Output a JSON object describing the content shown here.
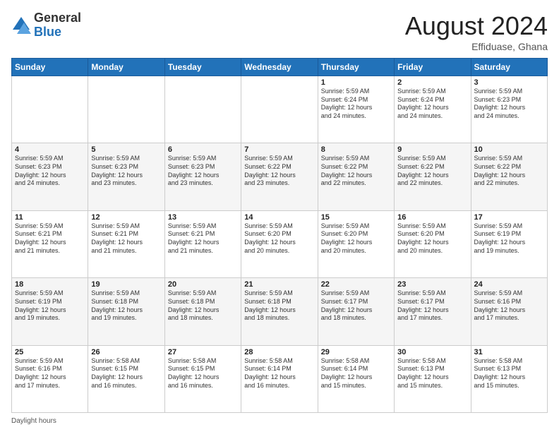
{
  "logo": {
    "general": "General",
    "blue": "Blue"
  },
  "header": {
    "month_year": "August 2024",
    "location": "Effiduase, Ghana"
  },
  "days_of_week": [
    "Sunday",
    "Monday",
    "Tuesday",
    "Wednesday",
    "Thursday",
    "Friday",
    "Saturday"
  ],
  "footer": {
    "daylight_label": "Daylight hours"
  },
  "weeks": [
    [
      {
        "day": "",
        "info": ""
      },
      {
        "day": "",
        "info": ""
      },
      {
        "day": "",
        "info": ""
      },
      {
        "day": "",
        "info": ""
      },
      {
        "day": "1",
        "info": "Sunrise: 5:59 AM\nSunset: 6:24 PM\nDaylight: 12 hours\nand 24 minutes."
      },
      {
        "day": "2",
        "info": "Sunrise: 5:59 AM\nSunset: 6:24 PM\nDaylight: 12 hours\nand 24 minutes."
      },
      {
        "day": "3",
        "info": "Sunrise: 5:59 AM\nSunset: 6:23 PM\nDaylight: 12 hours\nand 24 minutes."
      }
    ],
    [
      {
        "day": "4",
        "info": "Sunrise: 5:59 AM\nSunset: 6:23 PM\nDaylight: 12 hours\nand 24 minutes."
      },
      {
        "day": "5",
        "info": "Sunrise: 5:59 AM\nSunset: 6:23 PM\nDaylight: 12 hours\nand 23 minutes."
      },
      {
        "day": "6",
        "info": "Sunrise: 5:59 AM\nSunset: 6:23 PM\nDaylight: 12 hours\nand 23 minutes."
      },
      {
        "day": "7",
        "info": "Sunrise: 5:59 AM\nSunset: 6:22 PM\nDaylight: 12 hours\nand 23 minutes."
      },
      {
        "day": "8",
        "info": "Sunrise: 5:59 AM\nSunset: 6:22 PM\nDaylight: 12 hours\nand 22 minutes."
      },
      {
        "day": "9",
        "info": "Sunrise: 5:59 AM\nSunset: 6:22 PM\nDaylight: 12 hours\nand 22 minutes."
      },
      {
        "day": "10",
        "info": "Sunrise: 5:59 AM\nSunset: 6:22 PM\nDaylight: 12 hours\nand 22 minutes."
      }
    ],
    [
      {
        "day": "11",
        "info": "Sunrise: 5:59 AM\nSunset: 6:21 PM\nDaylight: 12 hours\nand 21 minutes."
      },
      {
        "day": "12",
        "info": "Sunrise: 5:59 AM\nSunset: 6:21 PM\nDaylight: 12 hours\nand 21 minutes."
      },
      {
        "day": "13",
        "info": "Sunrise: 5:59 AM\nSunset: 6:21 PM\nDaylight: 12 hours\nand 21 minutes."
      },
      {
        "day": "14",
        "info": "Sunrise: 5:59 AM\nSunset: 6:20 PM\nDaylight: 12 hours\nand 20 minutes."
      },
      {
        "day": "15",
        "info": "Sunrise: 5:59 AM\nSunset: 6:20 PM\nDaylight: 12 hours\nand 20 minutes."
      },
      {
        "day": "16",
        "info": "Sunrise: 5:59 AM\nSunset: 6:20 PM\nDaylight: 12 hours\nand 20 minutes."
      },
      {
        "day": "17",
        "info": "Sunrise: 5:59 AM\nSunset: 6:19 PM\nDaylight: 12 hours\nand 19 minutes."
      }
    ],
    [
      {
        "day": "18",
        "info": "Sunrise: 5:59 AM\nSunset: 6:19 PM\nDaylight: 12 hours\nand 19 minutes."
      },
      {
        "day": "19",
        "info": "Sunrise: 5:59 AM\nSunset: 6:18 PM\nDaylight: 12 hours\nand 19 minutes."
      },
      {
        "day": "20",
        "info": "Sunrise: 5:59 AM\nSunset: 6:18 PM\nDaylight: 12 hours\nand 18 minutes."
      },
      {
        "day": "21",
        "info": "Sunrise: 5:59 AM\nSunset: 6:18 PM\nDaylight: 12 hours\nand 18 minutes."
      },
      {
        "day": "22",
        "info": "Sunrise: 5:59 AM\nSunset: 6:17 PM\nDaylight: 12 hours\nand 18 minutes."
      },
      {
        "day": "23",
        "info": "Sunrise: 5:59 AM\nSunset: 6:17 PM\nDaylight: 12 hours\nand 17 minutes."
      },
      {
        "day": "24",
        "info": "Sunrise: 5:59 AM\nSunset: 6:16 PM\nDaylight: 12 hours\nand 17 minutes."
      }
    ],
    [
      {
        "day": "25",
        "info": "Sunrise: 5:59 AM\nSunset: 6:16 PM\nDaylight: 12 hours\nand 17 minutes."
      },
      {
        "day": "26",
        "info": "Sunrise: 5:58 AM\nSunset: 6:15 PM\nDaylight: 12 hours\nand 16 minutes."
      },
      {
        "day": "27",
        "info": "Sunrise: 5:58 AM\nSunset: 6:15 PM\nDaylight: 12 hours\nand 16 minutes."
      },
      {
        "day": "28",
        "info": "Sunrise: 5:58 AM\nSunset: 6:14 PM\nDaylight: 12 hours\nand 16 minutes."
      },
      {
        "day": "29",
        "info": "Sunrise: 5:58 AM\nSunset: 6:14 PM\nDaylight: 12 hours\nand 15 minutes."
      },
      {
        "day": "30",
        "info": "Sunrise: 5:58 AM\nSunset: 6:13 PM\nDaylight: 12 hours\nand 15 minutes."
      },
      {
        "day": "31",
        "info": "Sunrise: 5:58 AM\nSunset: 6:13 PM\nDaylight: 12 hours\nand 15 minutes."
      }
    ]
  ]
}
